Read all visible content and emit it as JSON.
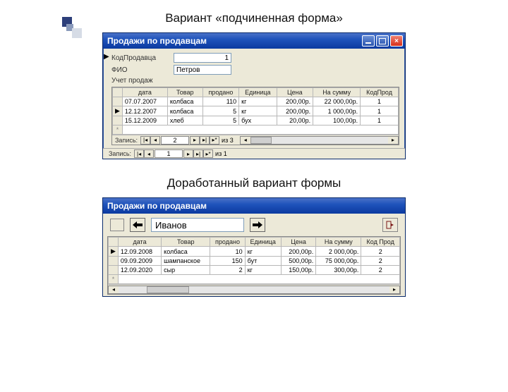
{
  "headings": {
    "variant": "Вариант  «подчиненная форма»",
    "improved": "Доработанный вариант формы"
  },
  "window1": {
    "title": "Продажи по продавцам",
    "fields": {
      "code_label": "КодПродавца",
      "code_value": "1",
      "fio_label": "ФИО",
      "fio_value": "Петров",
      "cyr_label": "Учет продаж",
      "cyr_value": ""
    },
    "columns": [
      "дата",
      "Товар",
      "продано",
      "Единица",
      "Цена",
      "На сумму",
      "КодПрод"
    ],
    "rows": [
      {
        "mark": "",
        "d": "07.07.2007",
        "t": "колбаса",
        "q": "110",
        "u": "кг",
        "p": "200,00р.",
        "s": "22 000,00р.",
        "k": "1"
      },
      {
        "mark": "▶",
        "d": "12.12.2007",
        "t": "колбаса",
        "q": "5",
        "u": "кг",
        "p": "200,00р.",
        "s": "1 000,00р.",
        "k": "1"
      },
      {
        "mark": "",
        "d": "15.12.2009",
        "t": "хлеб",
        "q": "5",
        "u": "бух",
        "p": "20,00р.",
        "s": "100,00р.",
        "k": "1"
      }
    ],
    "newrow_mark": "*",
    "sub_nav": {
      "label": "Запись:",
      "pos": "2",
      "of": "из 3"
    },
    "outer_nav": {
      "label": "Запись:",
      "pos": "1",
      "of": "из 1"
    }
  },
  "window2": {
    "title": "Продажи по продавцам",
    "seller": "Иванов",
    "columns": [
      "дата",
      "Товар",
      "продано",
      "Единица",
      "Цена",
      "На сумму",
      "Код Прод"
    ],
    "rows": [
      {
        "mark": "▶",
        "d": "12.09.2008",
        "t": "колбаса",
        "q": "10",
        "u": "кг",
        "p": "200,00р.",
        "s": "2 000,00р.",
        "k": "2"
      },
      {
        "mark": "",
        "d": "09.09.2009",
        "t": "шампанское",
        "q": "150",
        "u": "бут",
        "p": "500,00р.",
        "s": "75 000,00р.",
        "k": "2"
      },
      {
        "mark": "",
        "d": "12.09.2020",
        "t": "сыр",
        "q": "2",
        "u": "кг",
        "p": "150,00р.",
        "s": "300,00р.",
        "k": "2"
      }
    ],
    "newrow_mark": "*"
  }
}
